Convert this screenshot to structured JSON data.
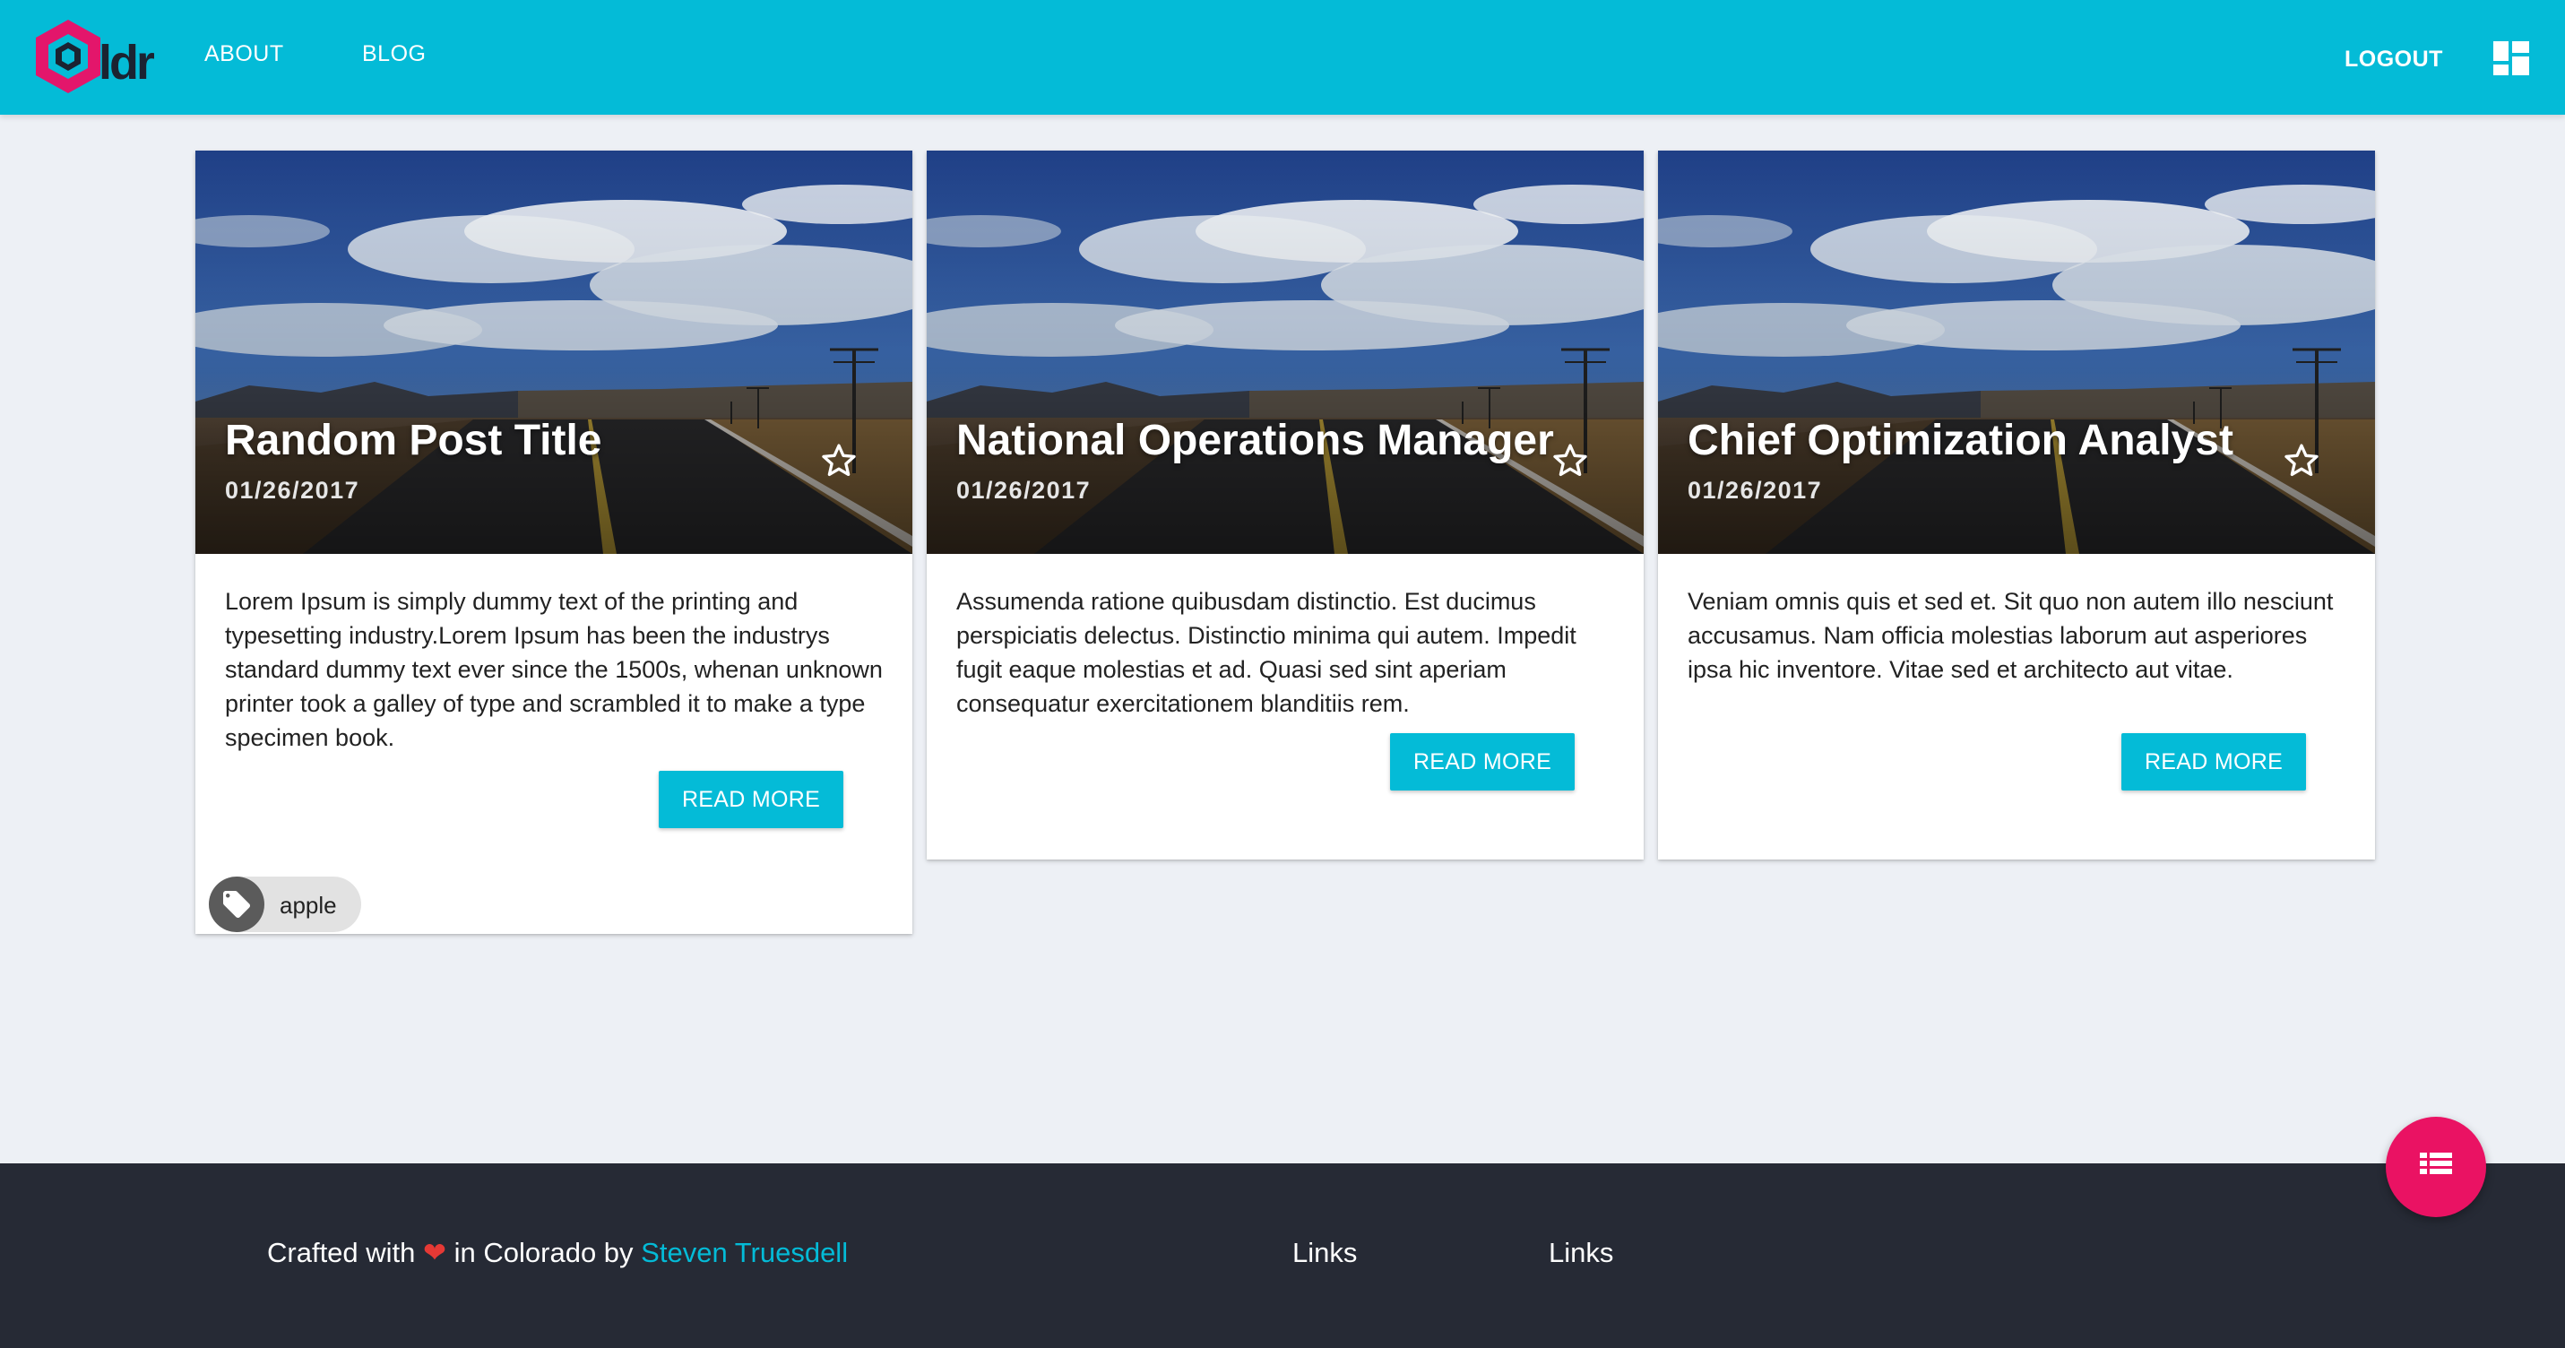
{
  "header": {
    "logo_alt": "bldr",
    "nav": [
      {
        "label": "ABOUT"
      },
      {
        "label": "BLOG"
      }
    ],
    "logout_label": "LOGOUT",
    "menu_icon": "dashboard-icon"
  },
  "posts": [
    {
      "title": "Random Post Title",
      "date": "01/26/2017",
      "excerpt": "Lorem Ipsum is simply dummy text of the printing and typesetting industry.Lorem Ipsum has been the industrys standard dummy text ever since the 1500s, whenan unknown printer took a galley of type and scrambled it to make a type specimen book.",
      "read_more_label": "READ MORE",
      "favorite_icon": "star-outline-icon",
      "tags": [
        {
          "label": "apple",
          "icon": "tag-icon"
        }
      ]
    },
    {
      "title": "National Operations Manager",
      "date": "01/26/2017",
      "excerpt": "Assumenda ratione quibusdam distinctio. Est ducimus perspiciatis delectus. Distinctio minima qui autem. Impedit fugit eaque molestias et ad. Quasi sed sint aperiam consequatur exercitationem blanditiis rem.",
      "read_more_label": "READ MORE",
      "favorite_icon": "star-outline-icon",
      "tags": []
    },
    {
      "title": "Chief Optimization Analyst",
      "date": "01/26/2017",
      "excerpt": "Veniam omnis quis et sed et. Sit quo non autem illo nesciunt accusamus. Nam officia molestias laborum aut asperiores ipsa hic inventore. Vitae sed et architecto aut vitae.",
      "read_more_label": "READ MORE",
      "favorite_icon": "star-outline-icon",
      "tags": []
    }
  ],
  "footer": {
    "credit_prefix": "Crafted with",
    "credit_middle": "in Colorado by",
    "author": "Steven Truesdell",
    "links": [
      {
        "label": "Links"
      },
      {
        "label": "Links"
      }
    ]
  },
  "fab_icon": "list-icon",
  "colors": {
    "primary": "#04bbd7",
    "accent": "#ea1263",
    "footer_bg": "#262a35",
    "page_bg": "#edf0f5"
  }
}
